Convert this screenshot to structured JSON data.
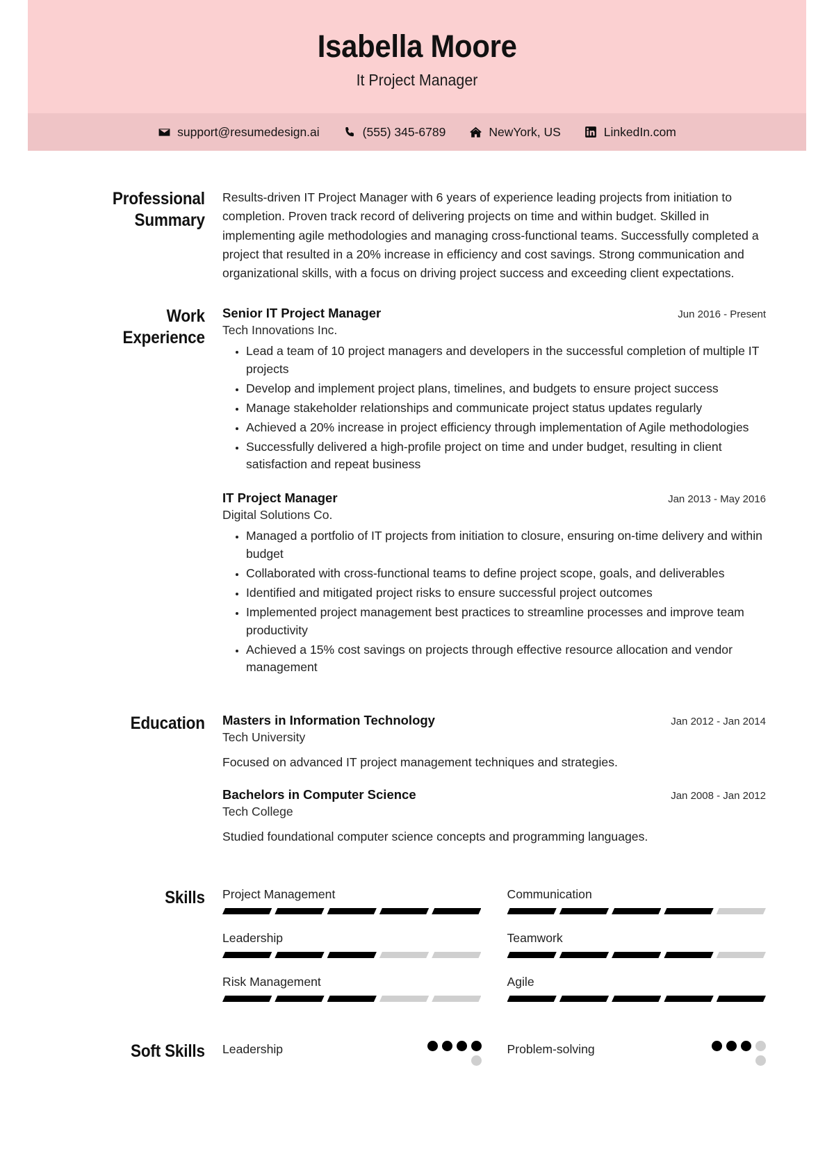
{
  "colors": {
    "header_bg": "#fbd0d1",
    "contact_bg": "#efc4c6",
    "filled": "#000000",
    "empty": "#cfcfcf",
    "text": "#222222"
  },
  "header": {
    "name": "Isabella Moore",
    "job_title": "It Project Manager"
  },
  "contact": [
    {
      "icon": "envelope-icon",
      "text": "support@resumedesign.ai"
    },
    {
      "icon": "phone-icon",
      "text": "(555) 345-6789"
    },
    {
      "icon": "home-icon",
      "text": "NewYork, US"
    },
    {
      "icon": "linkedin-icon",
      "text": "LinkedIn.com"
    }
  ],
  "summary": {
    "label": "Professional Summary",
    "text": "Results-driven IT Project Manager with 6 years of experience leading projects from initiation to completion. Proven track record of delivering projects on time and within budget. Skilled in implementing agile methodologies and managing cross-functional teams. Successfully completed a project that resulted in a 20% increase in efficiency and cost savings. Strong communication and organizational skills, with a focus on driving project success and exceeding client expectations."
  },
  "experience": {
    "label": "Work Experience",
    "entries": [
      {
        "title": "Senior IT Project Manager",
        "organization": "Tech Innovations Inc.",
        "date": "Jun 2016 - Present",
        "bullets": [
          "Lead a team of 10 project managers and developers in the successful completion of multiple IT projects",
          "Develop and implement project plans, timelines, and budgets to ensure project success",
          "Manage stakeholder relationships and communicate project status updates regularly",
          "Achieved a 20% increase in project efficiency through implementation of Agile methodologies",
          "Successfully delivered a high-profile project on time and under budget, resulting in client satisfaction and repeat business"
        ]
      },
      {
        "title": "IT Project Manager",
        "organization": "Digital Solutions Co.",
        "date": "Jan 2013 - May 2016",
        "bullets": [
          "Managed a portfolio of IT projects from initiation to closure, ensuring on-time delivery and within budget",
          "Collaborated with cross-functional teams to define project scope, goals, and deliverables",
          "Identified and mitigated project risks to ensure successful project outcomes",
          "Implemented project management best practices to streamline processes and improve team productivity",
          "Achieved a 15% cost savings on projects through effective resource allocation and vendor management"
        ]
      }
    ]
  },
  "education": {
    "label": "Education",
    "entries": [
      {
        "title": "Masters in Information Technology",
        "organization": "Tech University",
        "date": "Jan 2012 - Jan 2014",
        "description": "Focused on advanced IT project management techniques and strategies."
      },
      {
        "title": "Bachelors in Computer Science",
        "organization": "Tech College",
        "date": "Jan 2008 - Jan 2012",
        "description": "Studied foundational computer science concepts and programming languages."
      }
    ]
  },
  "skills": {
    "label": "Skills",
    "max_segments": 5,
    "items": [
      {
        "name": "Project Management",
        "level": 5
      },
      {
        "name": "Communication",
        "level": 4
      },
      {
        "name": "Leadership",
        "level": 3
      },
      {
        "name": "Teamwork",
        "level": 4
      },
      {
        "name": "Risk Management",
        "level": 3
      },
      {
        "name": "Agile",
        "level": 5
      }
    ]
  },
  "soft_skills": {
    "label": "Soft Skills",
    "max_dots": 5,
    "items": [
      {
        "name": "Leadership",
        "level": 4
      },
      {
        "name": "Problem-solving",
        "level": 3
      }
    ]
  }
}
